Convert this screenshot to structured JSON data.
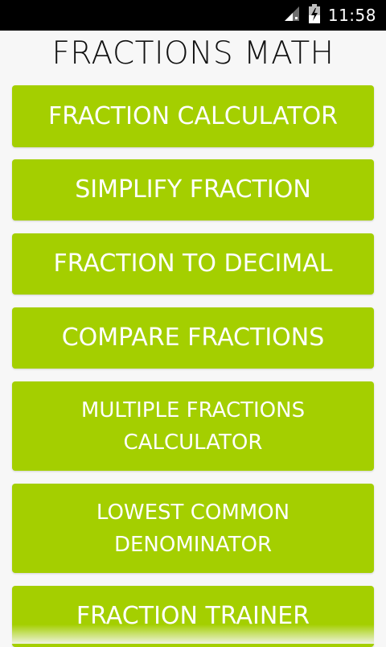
{
  "status_bar": {
    "time": "11:58",
    "icons": [
      "signal-icon",
      "battery-charging-icon"
    ]
  },
  "app": {
    "title": "FRACTIONS MATH"
  },
  "menu": {
    "items": [
      {
        "label": "FRACTION CALCULATOR"
      },
      {
        "label": "SIMPLIFY FRACTION"
      },
      {
        "label": "FRACTION TO DECIMAL"
      },
      {
        "label": "COMPARE FRACTIONS"
      },
      {
        "label": "MULTIPLE FRACTIONS\nCALCULATOR"
      },
      {
        "label": "LOWEST COMMON\nDENOMINATOR"
      },
      {
        "label": "FRACTION TRAINER"
      }
    ]
  },
  "colors": {
    "button_bg": "#a4cf00",
    "button_text": "#ffffff",
    "background": "#f7f7f7",
    "status_bar": "#000000"
  }
}
